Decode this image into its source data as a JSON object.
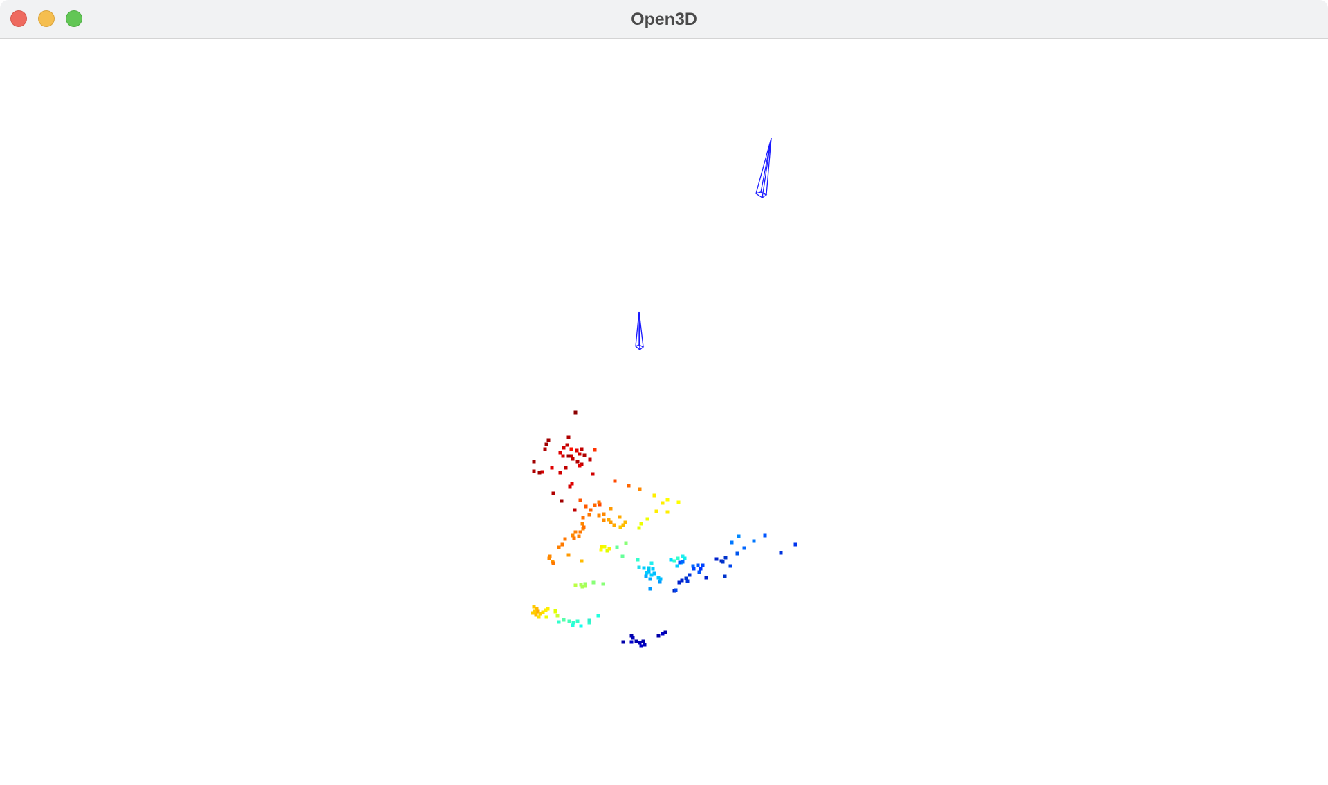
{
  "window": {
    "title": "Open3D"
  },
  "colors": {
    "titlebar_bg": "#f1f2f3",
    "close": "#ee6a5f",
    "minimize": "#f5be4f",
    "zoom": "#62c655",
    "frustum_line": "#1a1aff"
  },
  "scene": {
    "objects": [
      "camera-frustum",
      "camera-frustum",
      "point-cloud"
    ],
    "point_cloud_colormap": "jet"
  }
}
